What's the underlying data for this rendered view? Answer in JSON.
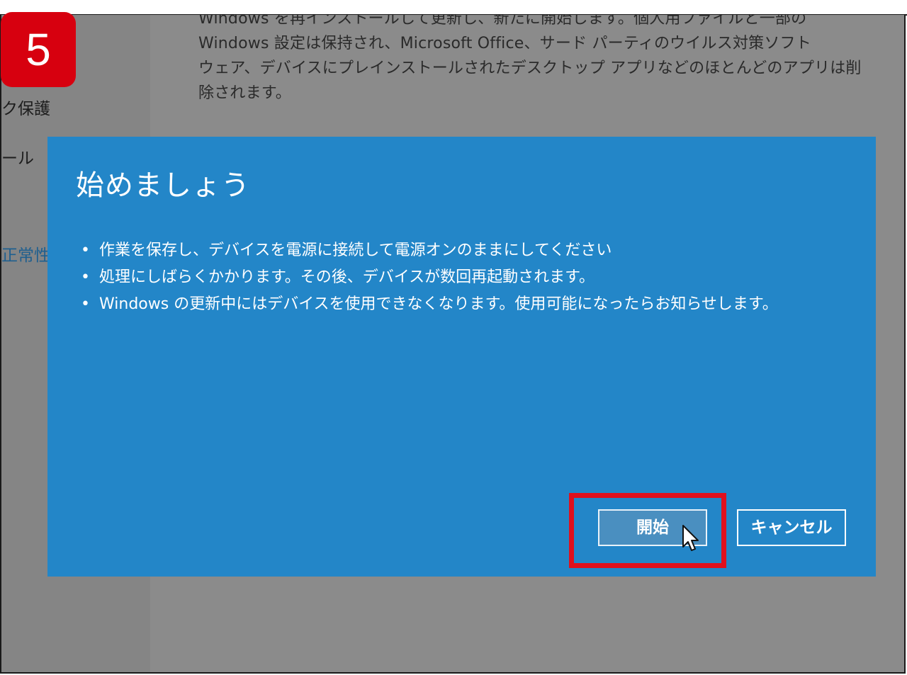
{
  "step_badge": "5",
  "background": {
    "settings_text_lines": [
      "Windows を再インストールして更新し、新たに開始します。個人用ファイルと一部の",
      "Windows 設定は保持され、Microsoft Office、サード パーティのウイルス対策ソフト",
      "ウェア、デバイスにプレインストールされたデスクトップ アプリなどのほとんどのアプリは削",
      "除されます。"
    ],
    "sidebar_items": {
      "protection": "ク保護",
      "tool": "ール",
      "health": "正常性"
    }
  },
  "dialog": {
    "title": "始めましょう",
    "bullets": [
      "作業を保存し、デバイスを電源に接続して電源オンのままにしてください",
      "処理にしばらくかかります。その後、デバイスが数回再起動されます。",
      "Windows の更新中にはデバイスを使用できなくなります。使用可能になったらお知らせします。"
    ],
    "bullet_glyph": "•",
    "start_button": "開始",
    "cancel_button": "キャンセル"
  },
  "colors": {
    "dialog_bg": "#2386c8",
    "badge_bg": "#d7000f",
    "highlight": "#e0101d",
    "overlay_bg": "#8b8b8b"
  },
  "icons": {
    "pointer": "mouse-pointer-icon"
  }
}
